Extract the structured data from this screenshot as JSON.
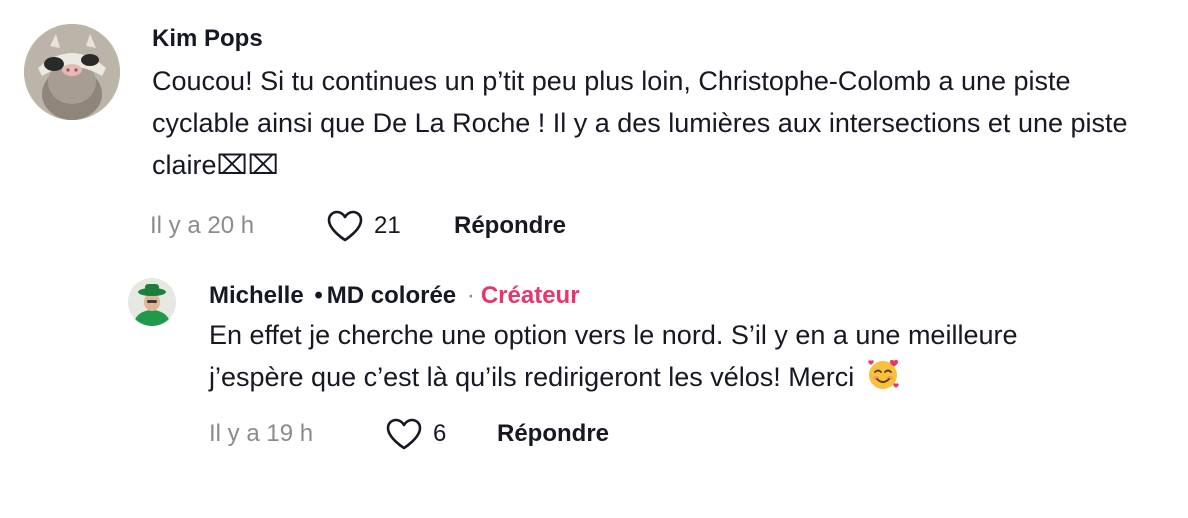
{
  "comments": [
    {
      "username": "Kim Pops",
      "text": "Coucou! Si tu continues un p’tit peu plus loin, Christophe-Colomb a une piste cyclable ainsi que De La Roche ! Il y a des lumières aux intersections et une piste claire⌧⌧",
      "time": "Il y a 20 h",
      "likes": "21",
      "reply_label": "Répondre"
    }
  ],
  "reply": {
    "username": "Michelle",
    "separator": "•",
    "subtitle": "MD colorée",
    "middle_dot": "·",
    "badge": "Créateur",
    "text": "En effet je cherche une option vers le nord. S’il y en a une meilleure j’espère que c’est là qu’ils redirigeront les vélos! Merci",
    "emoji": "smiling-face-with-hearts-icon",
    "time": "Il y a 19 h",
    "likes": "6",
    "reply_label": "Répondre"
  },
  "colors": {
    "text": "#161823",
    "muted": "#8a8b91",
    "creator_badge": "#e8356b"
  }
}
